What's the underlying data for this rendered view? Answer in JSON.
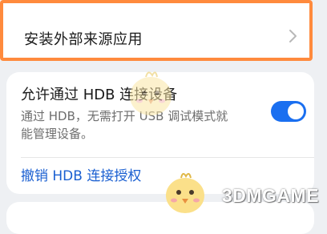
{
  "install_external": {
    "label": "安装外部来源应用"
  },
  "hdb": {
    "title": "允许通过 HDB 连接设备",
    "description": "通过 HDB，无需打开 USB 调试模式就能管理设备。",
    "enabled": true,
    "revoke_label": "撤销 HDB 连接授权"
  },
  "watermark": {
    "text": "3DMGAME"
  },
  "colors": {
    "highlight_border": "#ff8a3d",
    "toggle_on": "#1a6ff0",
    "link": "#1a5fd1",
    "background": "#eef0f3"
  },
  "icons": {
    "row_arrow": "chevron-right-icon",
    "mascot": "chick-mascot-icon"
  }
}
